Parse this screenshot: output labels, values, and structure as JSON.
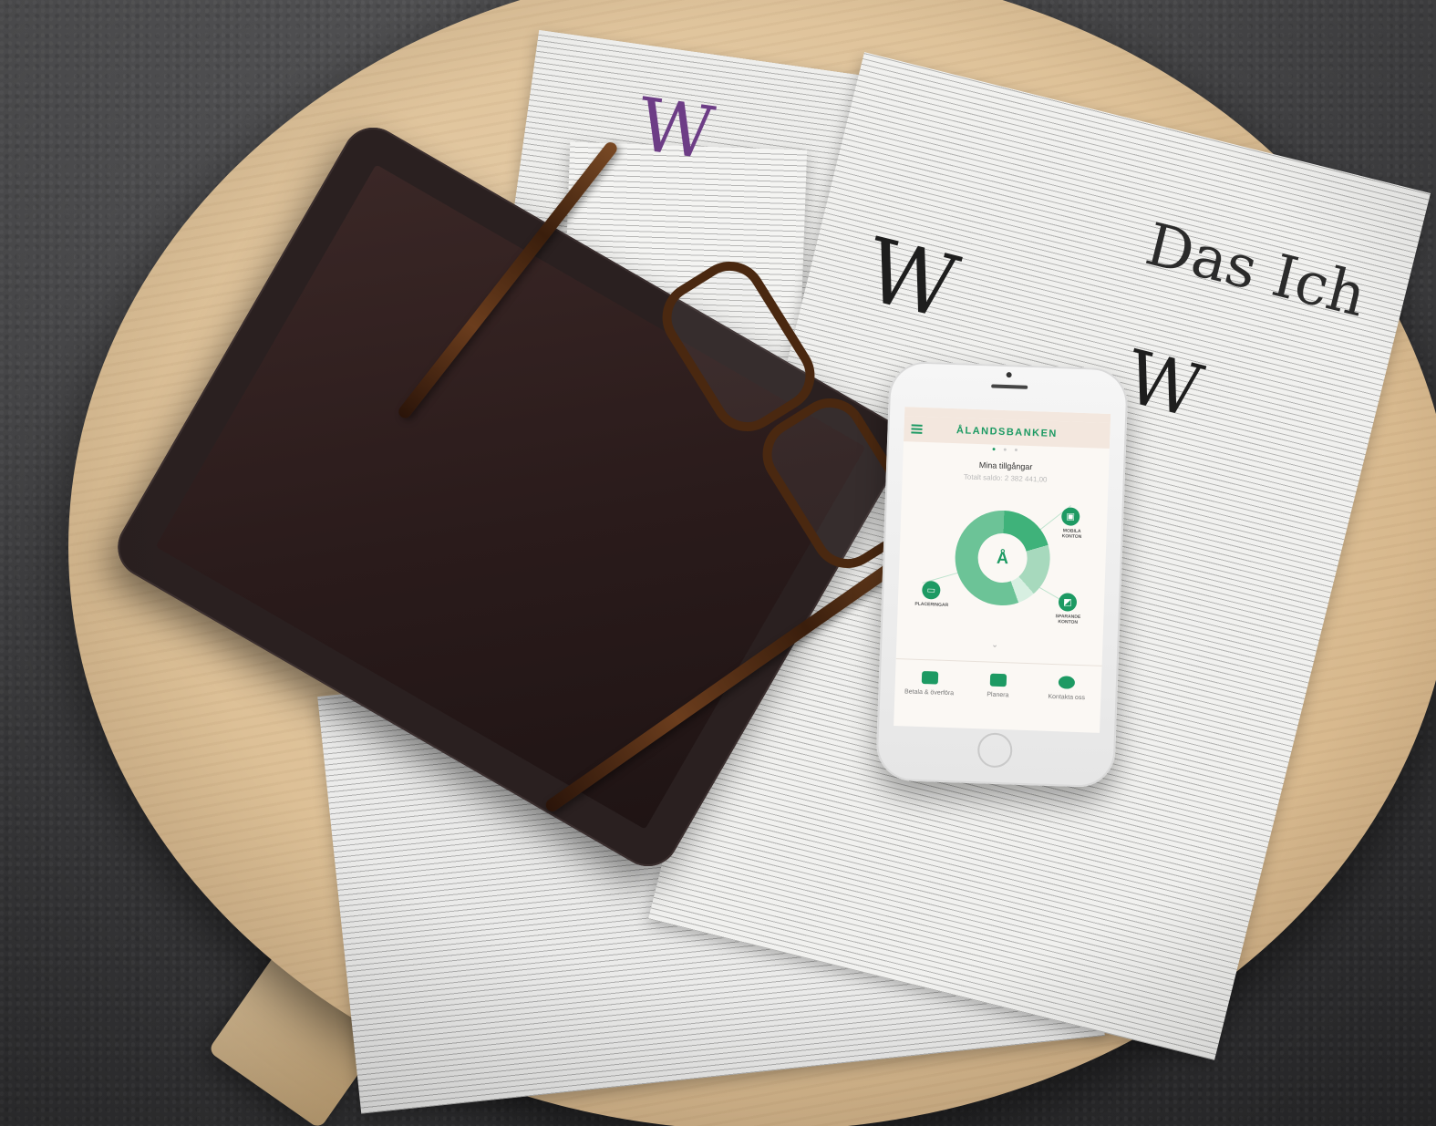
{
  "newspaper": {
    "headline": "Das Ich",
    "dropcap": "W"
  },
  "phone_app": {
    "brand": "ÅLANDSBANKEN",
    "page_dots": [
      "active",
      "inactive",
      "inactive"
    ],
    "heading": "Mina tillgångar",
    "total": "Totalt saldo: 2 382 441,00",
    "center_glyph": "Å",
    "nodes": [
      {
        "name": "mobila-konton",
        "label": "MOBILA KONTON"
      },
      {
        "name": "placeringar",
        "label": "PLACERINGAR"
      },
      {
        "name": "sparande-konton",
        "label": "SPARANDE KONTON"
      }
    ],
    "tabs": [
      {
        "label": "Betala & överföra"
      },
      {
        "label": "Planera"
      },
      {
        "label": "Kontakta oss"
      }
    ],
    "colors": {
      "brand_green": "#1d9a63",
      "topbar": "#f3e7de",
      "screen_bg": "#fbf8f4"
    }
  }
}
